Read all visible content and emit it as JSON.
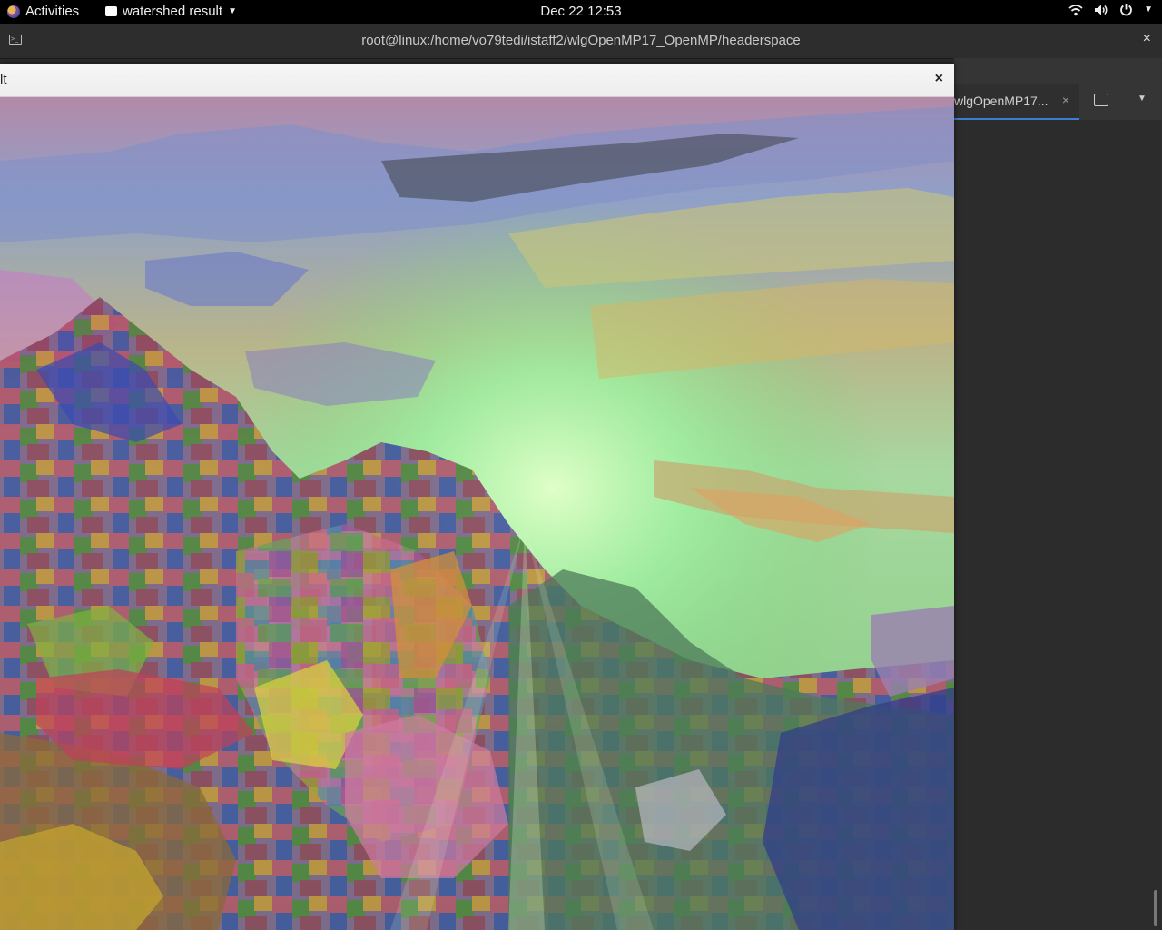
{
  "topbar": {
    "activities": "Activities",
    "app_name": "watershed result",
    "clock": "Dec 22  12:53"
  },
  "terminal": {
    "title": "root@linux:/home/vo79tedi/istaff2/wlgOpenMP17_OpenMP/headerspace",
    "tab_label": "wlgOpenMP17...",
    "close_glyph": "×"
  },
  "watershed_window": {
    "title": "lt",
    "close_glyph": "×"
  },
  "colors": {
    "topbar_bg": "#000000",
    "terminal_bg": "#2c2c2c",
    "tab_accent": "#3b7fd4"
  }
}
